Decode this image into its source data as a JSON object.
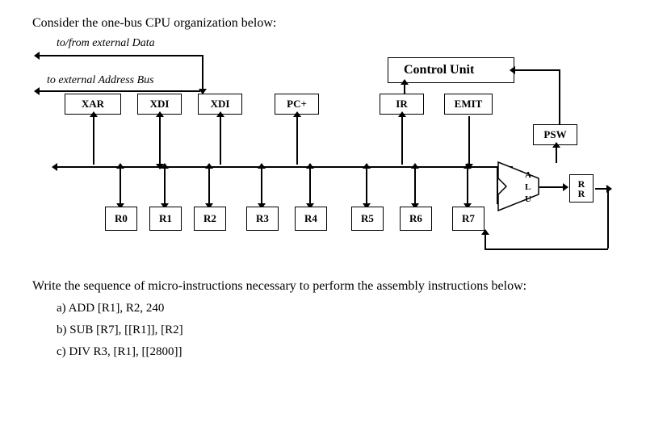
{
  "intro": "Consider the one-bus CPU organization below:",
  "labels": {
    "external_data": "to/from external Data",
    "external_addr": "to external Address Bus",
    "control_unit": "Control Unit"
  },
  "top_boxes": {
    "xar": "XAR",
    "xdi1": "XDI",
    "xdi2": "XDI",
    "pcplus": "PC+",
    "ir": "IR",
    "emit": "EMIT",
    "psw": "PSW"
  },
  "regs": {
    "r0": "R0",
    "r1": "R1",
    "r2": "R2",
    "r3": "R3",
    "r4": "R4",
    "r5": "R5",
    "r6": "R6",
    "r7": "R7"
  },
  "alu": {
    "a": "A",
    "l": "L",
    "u": "U"
  },
  "rr": {
    "r1": "R",
    "r2": "R"
  },
  "question": "Write the sequence of micro-instructions necessary to perform the assembly instructions below:",
  "items": {
    "a": "a)  ADD [R1], R2, 240",
    "b": "b)  SUB [R7], [[R1]], [R2]",
    "c": "c)  DIV R3, [R1], [[2800]]"
  },
  "chart_data": {
    "type": "diagram",
    "description": "One-bus CPU organization",
    "bus": "single horizontal internal bus",
    "units_above_bus": [
      "XAR",
      "XDI",
      "XDI",
      "PC+",
      "IR",
      "EMIT"
    ],
    "units_below_bus": [
      "R0",
      "R1",
      "R2",
      "R3",
      "R4",
      "R5",
      "R6",
      "R7"
    ],
    "right_side": [
      "ALU",
      "RR",
      "PSW"
    ],
    "external": {
      "data_bus": "bidirectional to/from external Data (via XDI)",
      "address_bus": "to external Address Bus (from XAR)"
    },
    "control_unit_connections": [
      "IR (up)",
      "PSW (feedback)",
      "EMIT area"
    ],
    "alu_inputs_from": "bus",
    "alu_output_to": "RR then bus",
    "psw_connects": [
      "ALU flags",
      "Control Unit"
    ]
  }
}
